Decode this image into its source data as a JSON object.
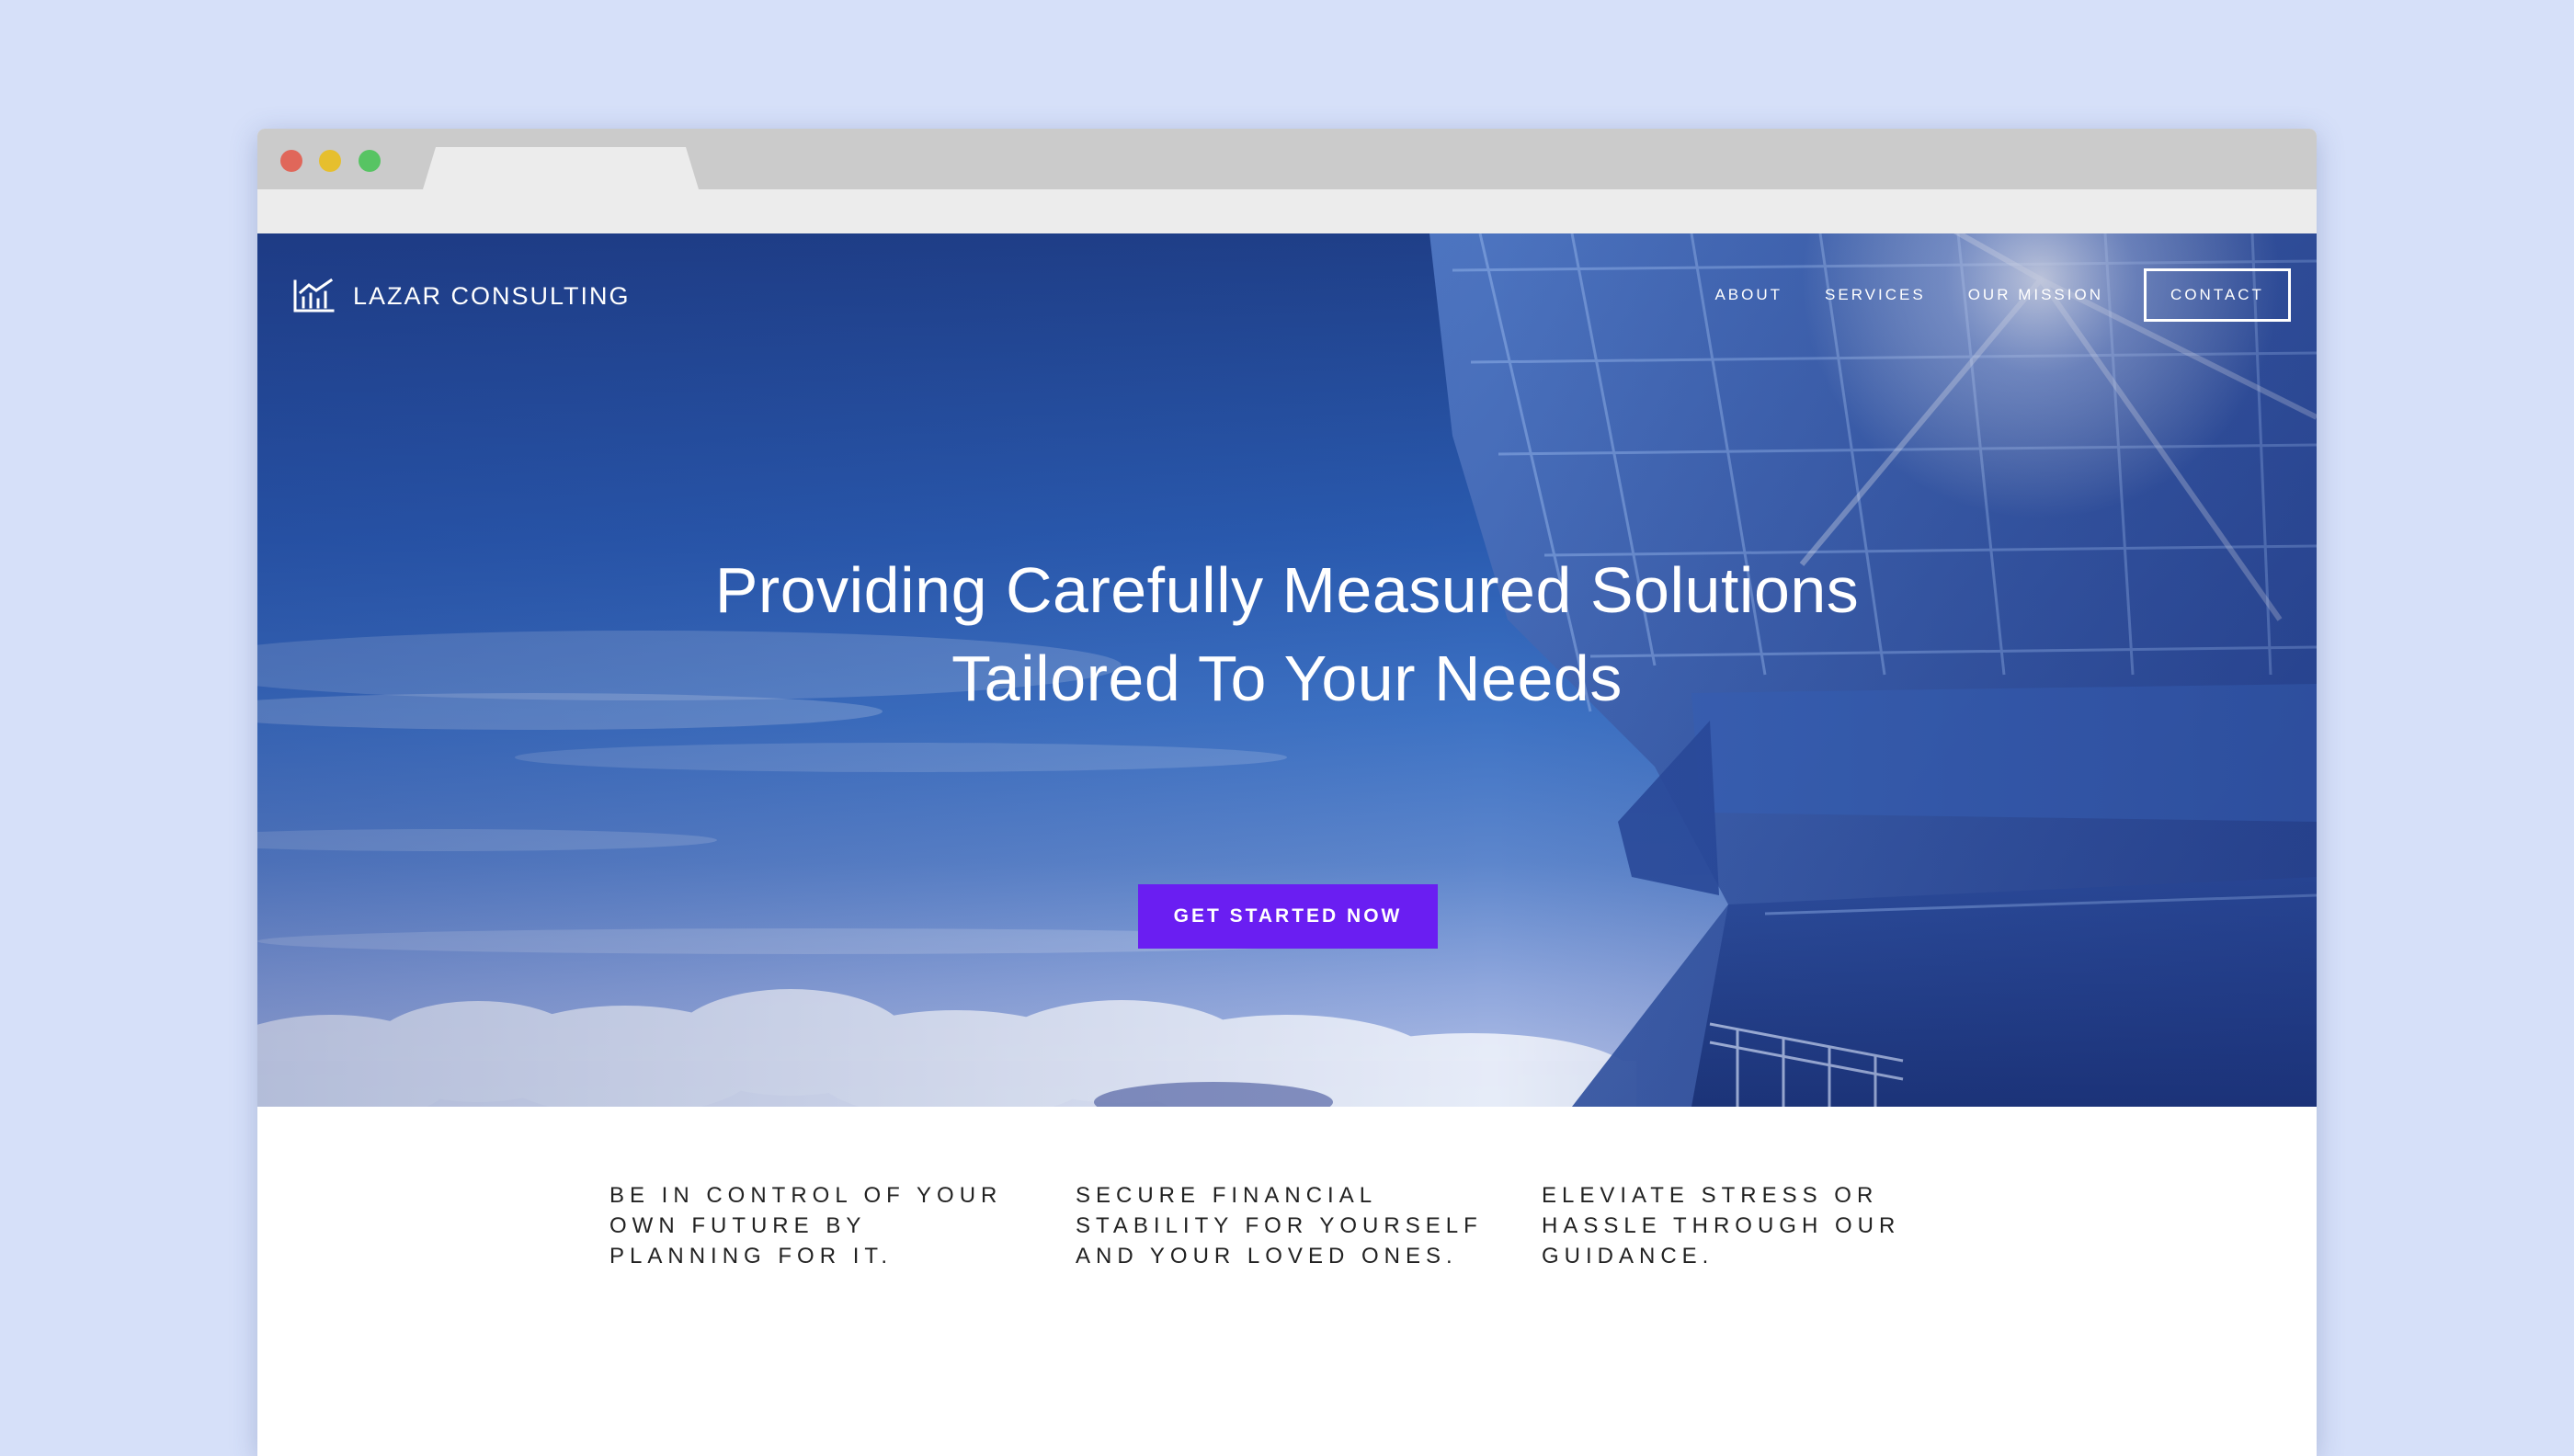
{
  "browser": {
    "controls": [
      "close",
      "minimize",
      "maximize"
    ]
  },
  "brand": {
    "name": "LAZAR CONSULTING",
    "icon": "bar-chart-trend-icon"
  },
  "nav": {
    "items": [
      "ABOUT",
      "SERVICES",
      "OUR MISSION"
    ],
    "contact": "CONTACT"
  },
  "hero": {
    "headline_line1": "Providing Carefully Measured Solutions",
    "headline_line2": "Tailored To Your Needs",
    "cta": "GET STARTED NOW"
  },
  "features": [
    "BE IN CONTROL OF YOUR OWN FUTURE BY PLANNING FOR IT.",
    "SECURE FINANCIAL STABILITY FOR YOURSELF AND YOUR LOVED ONES.",
    "ELEVIATE STRESS OR HASSLE THROUGH OUR GUIDANCE."
  ],
  "colors": {
    "page_background": "#d6e0f9",
    "hero_blue": "#2a5bb0",
    "cta_purple": "#6a1ef2",
    "text_dark": "#222222"
  }
}
